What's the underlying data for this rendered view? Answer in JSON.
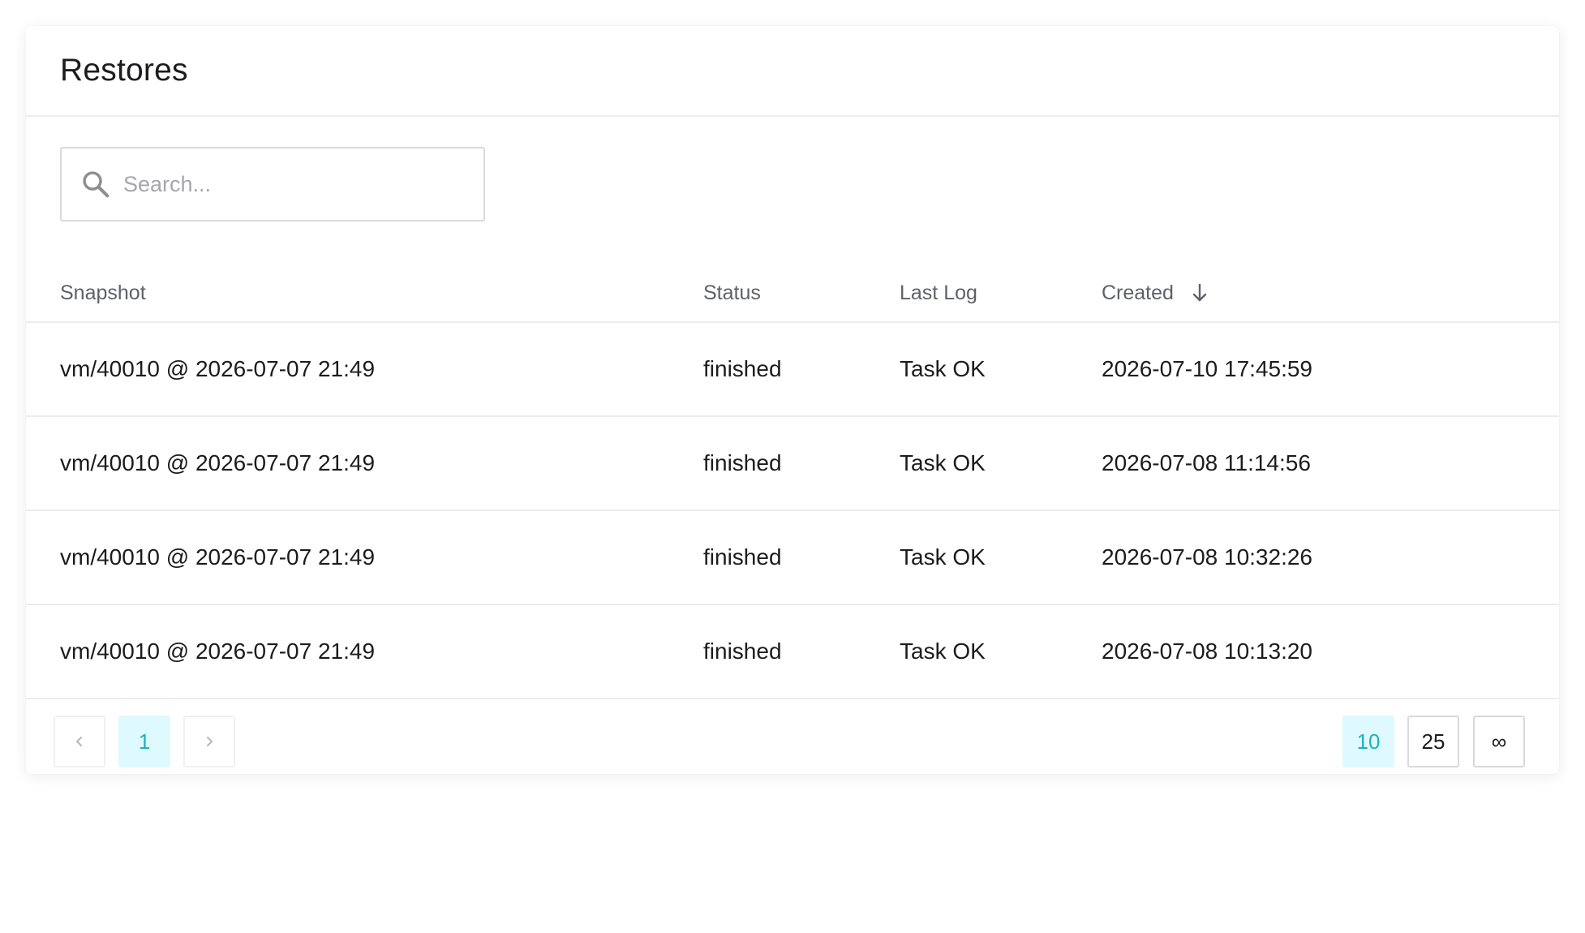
{
  "header": {
    "title": "Restores"
  },
  "search": {
    "placeholder": "Search..."
  },
  "table": {
    "columns": {
      "snapshot": "Snapshot",
      "status": "Status",
      "last_log": "Last Log",
      "created": "Created"
    },
    "sort": {
      "column": "created",
      "direction": "descending",
      "icon": "arrow-down-icon"
    },
    "rows": [
      {
        "snapshot": "vm/40010 @ 2026-07-07 21:49",
        "status": "finished",
        "last_log": "Task OK",
        "created": "2026-07-10 17:45:59"
      },
      {
        "snapshot": "vm/40010 @ 2026-07-07 21:49",
        "status": "finished",
        "last_log": "Task OK",
        "created": "2026-07-08 11:14:56"
      },
      {
        "snapshot": "vm/40010 @ 2026-07-07 21:49",
        "status": "finished",
        "last_log": "Task OK",
        "created": "2026-07-08 10:32:26"
      },
      {
        "snapshot": "vm/40010 @ 2026-07-07 21:49",
        "status": "finished",
        "last_log": "Task OK",
        "created": "2026-07-08 10:13:20"
      }
    ]
  },
  "pagination": {
    "prev_icon": "chevron-left-icon",
    "next_icon": "chevron-right-icon",
    "current_page": "1",
    "page_sizes": [
      "10",
      "25",
      "∞"
    ],
    "selected_page_size": "10"
  },
  "colors": {
    "accent": "#1fb0c4",
    "accent_bg": "#dffaff",
    "border": "#ececee",
    "muted_text": "#5f6169"
  }
}
